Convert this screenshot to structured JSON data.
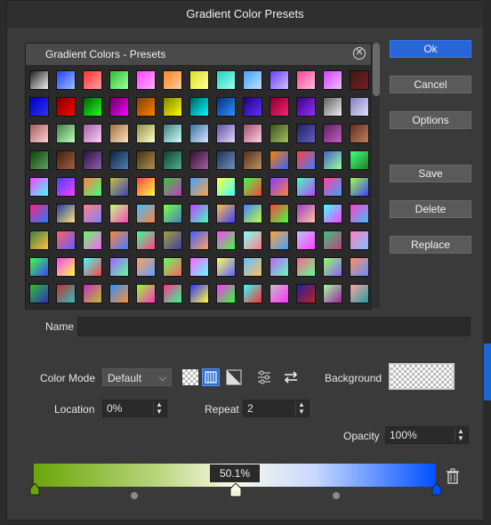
{
  "dialog": {
    "title": "Gradient Color Presets"
  },
  "presets": {
    "header": "Gradient Colors - Presets"
  },
  "buttons": {
    "ok": "Ok",
    "cancel": "Cancel",
    "options": "Options",
    "save": "Save",
    "delete": "Delete",
    "replace": "Replace"
  },
  "name": {
    "label": "Name",
    "value": ""
  },
  "color_mode": {
    "label": "Color Mode",
    "value": "Default"
  },
  "background": {
    "label": "Background"
  },
  "location": {
    "label": "Location",
    "value": "0%"
  },
  "repeat": {
    "label": "Repeat",
    "value": "2"
  },
  "opacity": {
    "label": "Opacity",
    "value": "100%"
  },
  "gradient": {
    "position_tooltip": "50.1%",
    "start_color": "#6aa50a",
    "end_color": "#0050ff"
  },
  "swatches": [
    [
      "#222,#eee",
      "#2040ff,#a0c0ff",
      "#ff3030,#ffa0a0",
      "#30c030,#a0ffa0",
      "#ff40ff,#ffb0ff",
      "#ff8020,#ffd0a0",
      "#e0e020,#ffffa0",
      "#20d0c0,#a0fff0",
      "#40a0ff,#c0e0ff",
      "#6040ff,#d0c0ff",
      "#ff4090,#ffc0e0",
      "#d040ff,#f0c0ff",
      "#401818,#702020"
    ],
    [
      "#0000c0,#3030ff",
      "#800000,#ff0000",
      "#006000,#20ff20",
      "#600060,#ff00ff",
      "#804000,#ff8000",
      "#808000,#ffff00",
      "#006060,#00ffff",
      "#003080,#3090ff",
      "#200080,#6030ff",
      "#800030,#ff2070",
      "#400080,#9030ff",
      "#606060,#f0f0f0",
      "#8080c0,#e0e0ff"
    ],
    [
      "#a06060,#ffd0d0",
      "#408040,#c0ffc0",
      "#a060a0,#ffd0ff",
      "#a07040,#ffe0c0",
      "#909040,#ffffd0",
      "#408080,#d0ffff",
      "#4070a0,#d0e8ff",
      "#6050a0,#e0d8ff",
      "#a05070,#ffd0e0",
      "#405020,#a0c060",
      "#202060,#6060c0",
      "#602060,#c060c0",
      "#603020,#c08060"
    ],
    [
      "#104010,#60a060",
      "#402010,#a06040",
      "#301040,#9060b0",
      "#102040,#5080b0",
      "#403010,#b09050",
      "#104030,#50b090",
      "#301030,#a060a0",
      "#203050,#7090c0",
      "#503020,#c09060",
      "#ff8000,#3060ff",
      "#ff4040,#4080ff",
      "#4060c0,#a0ffa0",
      "#40ff80,#208020"
    ],
    [
      "#ff40ff,#40ffff",
      "#4040ff,#ff40ff",
      "#ff8040,#40ff80",
      "#c0c040,#4040c0",
      "#ff4040,#ffff40",
      "#40c040,#c040c0",
      "#40a0ff,#ffa040",
      "#ffff40,#40ffff",
      "#40ff40,#ff4040",
      "#8040ff,#ff8040",
      "#40ffc0,#c040ff",
      "#ff40a0,#40a0ff",
      "#a0ff40,#4040ff"
    ],
    [
      "#ff2080,#2080ff",
      "#2040a0,#ffe080",
      "#ff8080,#8080ff",
      "#c0ff80,#ff40c0",
      "#40c0ff,#ff8040",
      "#80ff40,#4080c0",
      "#c040ff,#40ffc0",
      "#ffc040,#4040ff",
      "#4080ff,#c0ff40",
      "#ff4040,#40ff40",
      "#a040c0,#ffc0a0",
      "#40ffff,#ff40ff",
      "#ff40c0,#40c0ff"
    ],
    [
      "#408040,#ffc040",
      "#ff6060,#6060ff",
      "#60ff60,#ff60ff",
      "#ff8040,#4080ff",
      "#40ffa0,#ff4080",
      "#a0a040,#4040a0",
      "#4060ff,#ffa060",
      "#ff40ff,#40ff40",
      "#80ffff,#ff8080",
      "#ffa040,#40a0ff",
      "#c0c0ff,#ff40ff",
      "#40c080,#c04080",
      "#ff80c0,#80c0ff"
    ],
    [
      "#40ff40,#4040ff",
      "#ff40ff,#ffff40",
      "#40ffff,#ff4040",
      "#a060ff,#60ffa0",
      "#ffa060,#60a0ff",
      "#60ff60,#ff6060",
      "#ff60ff,#60ffff",
      "#ffff60,#6060ff",
      "#60c0ff,#ffc060",
      "#c060ff,#60ffc0",
      "#ff6090,#60ff90",
      "#90ff60,#9060ff",
      "#ff9060,#6090ff"
    ],
    [
      "#30c030,#3030c0",
      "#c03030,#30c0c0",
      "#c030c0,#c0c030",
      "#3090ff,#ff9030",
      "#90ff30,#ff30c0",
      "#ff3090,#30ff90",
      "#3030ff,#ffff30",
      "#ff30ff,#30ff30",
      "#30ffff,#ff3030",
      "#c0c0c0,#ff30ff",
      "#2020a0,#c02020",
      "#a0ffa0,#a020a0",
      "#ffa0a0,#20a0a0"
    ],
    [
      "#ff00c0,#00c0ff",
      "#ffd040,#ff4080",
      "#4080ff,#40ff80",
      "#ff80ff,#80ff80",
      "#8040c0,#40c080",
      "#ffff80,#ff80ff",
      "#40ffff,#4040ff",
      "#ff4080,#8040ff",
      "#80ff40,#4080ff",
      "#c080ff,#ff80c0",
      "#40c0c0,#c040ff",
      "#ff8080,#ffff40",
      "#ff40ff,#4040ff"
    ]
  ]
}
